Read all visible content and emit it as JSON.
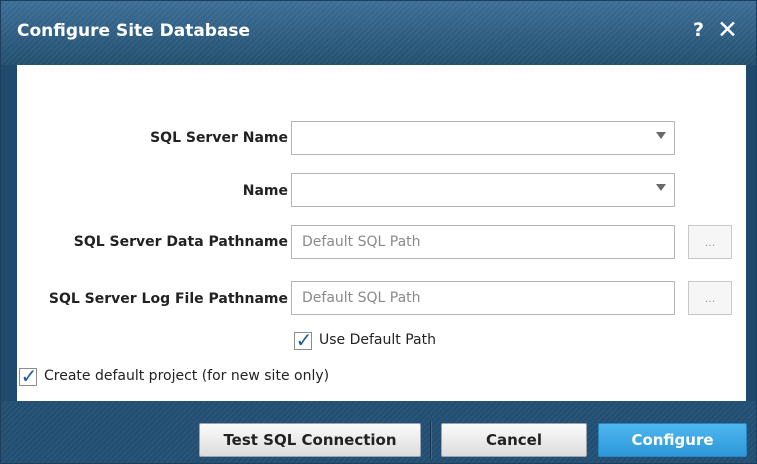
{
  "dialog": {
    "title": "Configure Site Database",
    "help_glyph": "?",
    "close_glyph": "✕"
  },
  "form": {
    "sql_server_name": {
      "label": "SQL Server Name",
      "value": ""
    },
    "name": {
      "label": "Name",
      "value": ""
    },
    "data_pathname": {
      "label": "SQL Server Data Pathname",
      "placeholder": "Default SQL Path",
      "browse_label": "..."
    },
    "log_pathname": {
      "label": "SQL Server Log File Pathname",
      "placeholder": "Default SQL Path",
      "browse_label": "..."
    },
    "use_default_path": {
      "label": "Use Default Path",
      "checked": true
    },
    "create_default_project": {
      "label": "Create default project (for new site only)",
      "checked": true
    }
  },
  "buttons": {
    "test_connection": "Test SQL Connection",
    "cancel": "Cancel",
    "configure": "Configure"
  },
  "colors": {
    "title_bar": "#2b5b82",
    "primary_button": "#2d98da",
    "checkmark": "#1e5e98"
  }
}
